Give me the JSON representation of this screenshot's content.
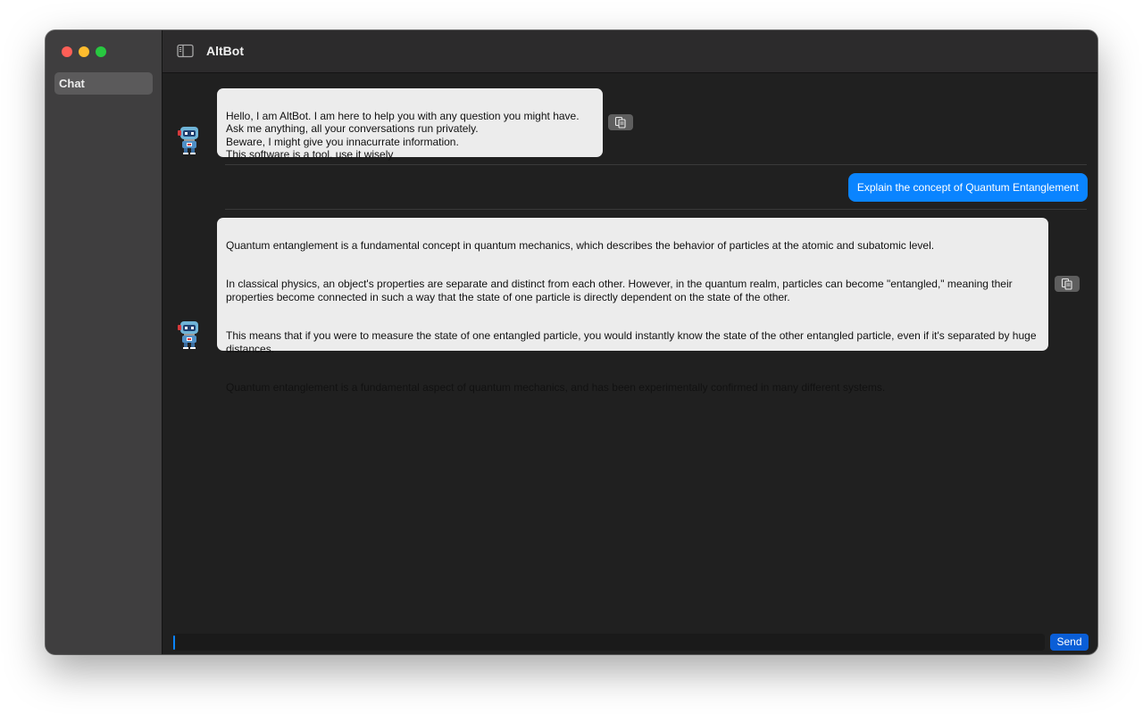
{
  "sidebar": {
    "items": [
      {
        "label": "Chat",
        "selected": true
      }
    ]
  },
  "header": {
    "title": "AltBot"
  },
  "messages": [
    {
      "role": "bot",
      "text": "Hello, I am AltBot. I am here to help you with any question you might have.\nAsk me anything, all your conversations run privately.\nBeware, I might give you innacurrate information.\nThis software is a tool, use it wisely"
    },
    {
      "role": "user",
      "text": "Explain the concept of Quantum Entanglement"
    },
    {
      "role": "bot",
      "paragraphs": [
        "Quantum entanglement is a fundamental concept in quantum mechanics, which describes the behavior of particles at the atomic and subatomic level.",
        "In classical physics, an object's properties are separate and distinct from each other. However, in the quantum realm, particles can become \"entangled,\" meaning their properties become connected in such a way that the state of one particle is directly dependent on the state of the other.",
        "This means that if you were to measure the state of one entangled particle, you would instantly know the state of the other entangled particle, even if it's separated by huge distances.",
        "Quantum entanglement is a fundamental aspect of quantum mechanics, and has been experimentally confirmed in many different systems."
      ]
    }
  ],
  "composer": {
    "value": "",
    "send_label": "Send"
  },
  "colors": {
    "accent": "#0a84ff",
    "bot_bubble": "#ececec",
    "send_button": "#0a5ed7"
  },
  "icons": {
    "window_close": "traffic-light-red",
    "window_minimize": "traffic-light-yellow",
    "window_zoom": "traffic-light-green",
    "sidebar_toggle": "sidebar-icon",
    "copy": "copy-icon",
    "bot_avatar": "robot-avatar"
  }
}
